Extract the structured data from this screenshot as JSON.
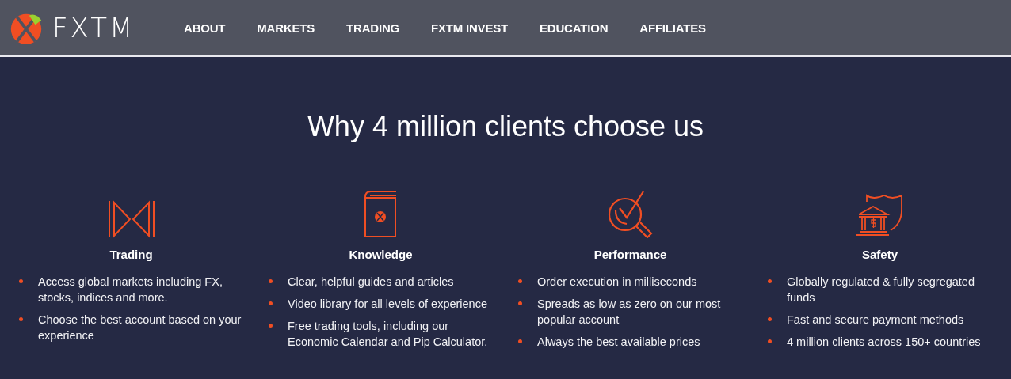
{
  "header": {
    "logo_text": "FXTM",
    "nav": [
      "ABOUT",
      "MARKETS",
      "TRADING",
      "FXTM INVEST",
      "EDUCATION",
      "AFFILIATES"
    ]
  },
  "section": {
    "title": "Why 4 million clients choose us",
    "features": [
      {
        "kind": "trading",
        "title": "Trading",
        "points": [
          "Access global markets including FX, stocks, indices and more.",
          "Choose the best account based on your experience"
        ]
      },
      {
        "kind": "knowledge",
        "title": "Knowledge",
        "points": [
          "Clear, helpful guides and articles",
          "Video library for all levels of experience",
          "Free trading tools, including our Economic Calendar and Pip Calculator."
        ]
      },
      {
        "kind": "performance",
        "title": "Performance",
        "points": [
          "Order execution in milliseconds",
          "Spreads as low as zero on our most popular account",
          "Always the best available prices"
        ]
      },
      {
        "kind": "safety",
        "title": "Safety",
        "points": [
          "Globally regulated & fully segregated funds",
          "Fast and secure payment methods",
          "4 million clients across 150+ countries"
        ]
      }
    ]
  }
}
